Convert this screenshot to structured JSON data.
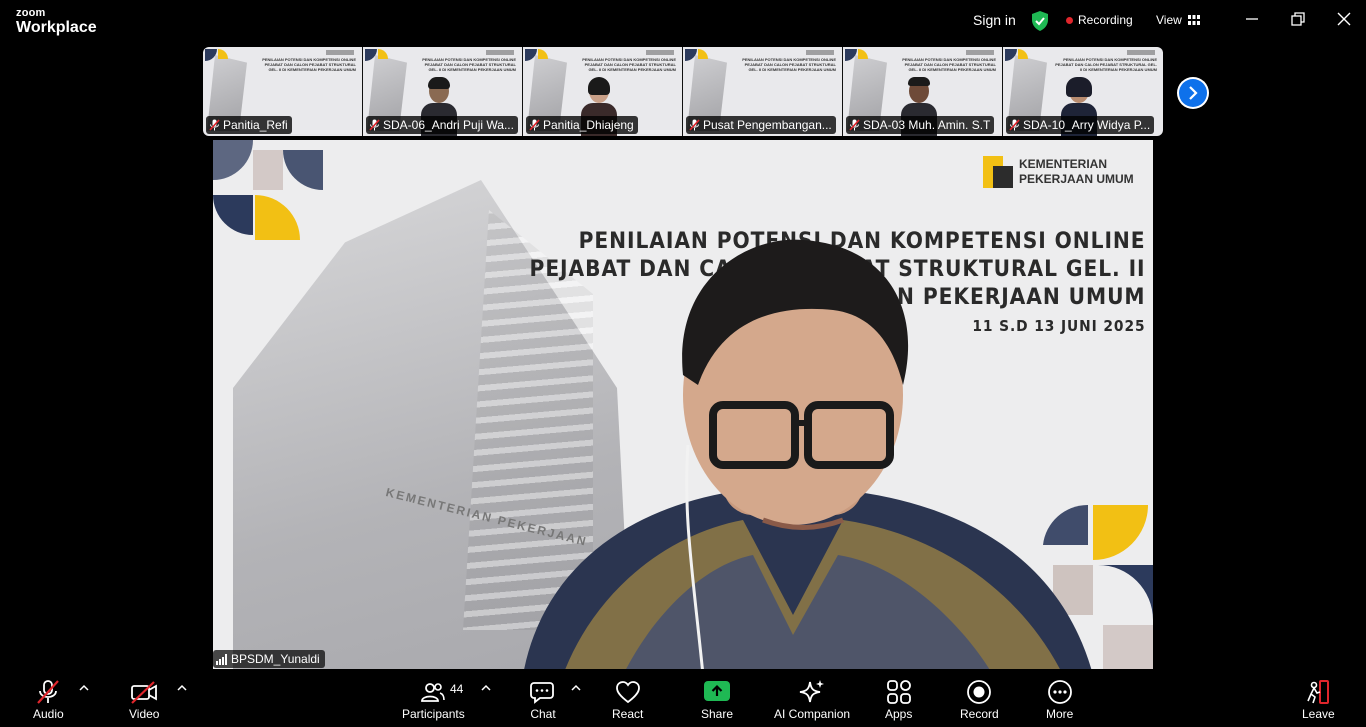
{
  "titlebar": {
    "brand_small": "zoom",
    "brand_big": "Workplace",
    "sign_in": "Sign in",
    "recording": "Recording",
    "view": "View"
  },
  "thumbnails": [
    {
      "name": "Panitia_Refi",
      "has_video": false
    },
    {
      "name": "SDA-06_Andri Puji Wa...",
      "has_video": true
    },
    {
      "name": "Panitia_Dhiajeng",
      "has_video": true
    },
    {
      "name": "Pusat Pengembangan...",
      "has_video": false
    },
    {
      "name": "SDA-03 Muh. Amin. S.T",
      "has_video": true
    },
    {
      "name": "SDA-10_Arry Widya P...",
      "has_video": true
    }
  ],
  "thumb_slide_text": "PENILAIAN POTENSI DAN KOMPETENSI ONLINE PEJABAT DAN CALON PEJABAT STRUKTURAL GEL. II DI KEMENTERIAN PEKERJAAN UMUM",
  "main_video": {
    "speaker_name": "BPSDM_Yunaldi",
    "logo_line1": "KEMENTERIAN",
    "logo_line2": "PEKERJAAN UMUM",
    "title_line1": "PENILAIAN POTENSI DAN KOMPETENSI ONLINE",
    "title_line2": "PEJABAT DAN CALON PEJABAT STRUKTURAL GEL. II",
    "title_line3": "DI KEMENTERIAN PEKERJAAN UMUM",
    "date": "11 S.D 13 JUNI 2025",
    "building_text": "KEMENTERIAN PEKERJAAN"
  },
  "toolbar": {
    "audio": "Audio",
    "video": "Video",
    "participants": "Participants",
    "participants_count": "44",
    "chat": "Chat",
    "react": "React",
    "share": "Share",
    "ai_companion": "AI Companion",
    "apps": "Apps",
    "record": "Record",
    "more": "More",
    "leave": "Leave"
  },
  "colors": {
    "share_green": "#1fb954",
    "shield_green": "#1fb954",
    "record_red": "#e0262c",
    "accent_blue": "#0e71eb",
    "leave_red": "#e0262c"
  }
}
